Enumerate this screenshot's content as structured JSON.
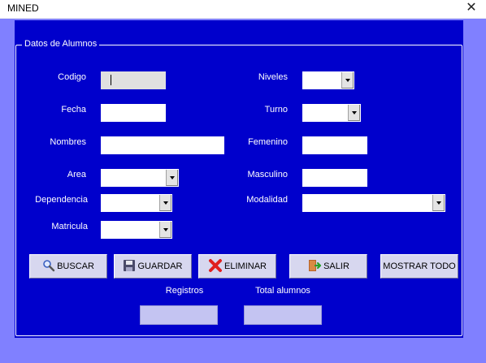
{
  "window": {
    "title": "MINED",
    "close_glyph": "✕"
  },
  "frame": {
    "legend": "Datos de Alumnos"
  },
  "fields": {
    "codigo": {
      "label": "Codigo",
      "value": ""
    },
    "fecha": {
      "label": "Fecha",
      "value": ""
    },
    "nombres": {
      "label": "Nombres",
      "value": ""
    },
    "area": {
      "label": "Area",
      "value": ""
    },
    "dependencia": {
      "label": "Dependencia",
      "value": ""
    },
    "matricula": {
      "label": "Matricula",
      "value": ""
    },
    "niveles": {
      "label": "Niveles",
      "value": ""
    },
    "turno": {
      "label": "Turno",
      "value": ""
    },
    "femenino": {
      "label": "Femenino",
      "value": ""
    },
    "masculino": {
      "label": "Masculino",
      "value": ""
    },
    "modalidad": {
      "label": "Modalidad",
      "value": ""
    }
  },
  "buttons": {
    "buscar": {
      "label": "BUSCAR",
      "icon": "magnifier-icon"
    },
    "guardar": {
      "label": "GUARDAR",
      "icon": "floppy-disk-icon"
    },
    "eliminar": {
      "label": "ELIMINAR",
      "icon": "red-x-icon"
    },
    "salir": {
      "label": "SALIR",
      "icon": "exit-door-icon"
    },
    "mostrar_todo": {
      "label": "MOSTRAR TODO"
    }
  },
  "summary": {
    "registros": {
      "label": "Registros",
      "value": ""
    },
    "total_alumnos": {
      "label": "Total alumnos",
      "value": ""
    }
  },
  "colors": {
    "form_bg": "#0000cc",
    "border": "#8080ff",
    "button": "#d7d7ef"
  }
}
